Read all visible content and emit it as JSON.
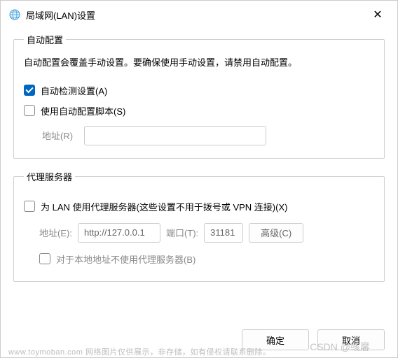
{
  "titlebar": {
    "title": "局域网(LAN)设置",
    "close_label": "✕"
  },
  "auto_config": {
    "legend": "自动配置",
    "description": "自动配置会覆盖手动设置。要确保使用手动设置，请禁用自动配置。",
    "auto_detect_label": "自动检测设置(A)",
    "auto_detect_checked": true,
    "use_script_label": "使用自动配置脚本(S)",
    "use_script_checked": false,
    "address_label": "地址(R)",
    "address_value": ""
  },
  "proxy": {
    "legend": "代理服务器",
    "use_proxy_label": "为 LAN 使用代理服务器(这些设置不用于拨号或 VPN 连接)(X)",
    "use_proxy_checked": false,
    "address_label": "地址(E):",
    "address_value": "http://127.0.0.1",
    "port_label": "端口(T):",
    "port_value": "31181",
    "advanced_label": "高级(C)",
    "bypass_label": "对于本地地址不使用代理服务器(B)",
    "bypass_checked": false
  },
  "buttons": {
    "ok": "确定",
    "cancel": "取消"
  },
  "watermark": "CSDN @彧黁",
  "bottomtext": "www.toymoban.com 网络图片仅供展示，非存储，如有侵权请联系删除。"
}
